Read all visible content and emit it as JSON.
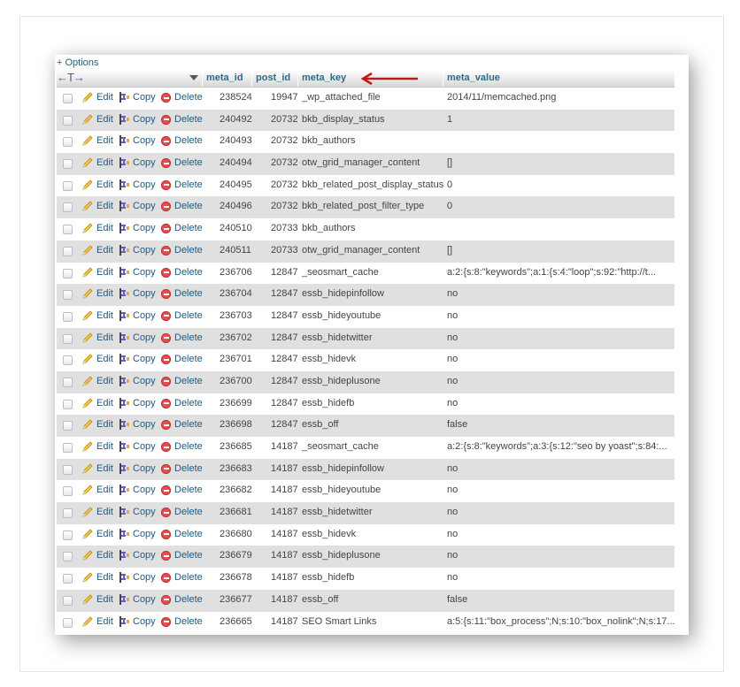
{
  "options_label": "Options",
  "options_prefix": "+",
  "columns": {
    "meta_id": "meta_id",
    "post_id": "post_id",
    "meta_key": "meta_key",
    "meta_value": "meta_value"
  },
  "actions": {
    "edit": "Edit",
    "copy": "Copy",
    "delete": "Delete"
  },
  "colors": {
    "link": "#235a81",
    "header_text": "#2e6a8a",
    "row_alt": "#e0e0e0",
    "annotation_arrow": "#c0191b"
  },
  "rows": [
    {
      "meta_id": "238524",
      "post_id": "19947",
      "meta_key": "_wp_attached_file",
      "meta_value": "2014/11/memcached.png"
    },
    {
      "meta_id": "240492",
      "post_id": "20732",
      "meta_key": "bkb_display_status",
      "meta_value": "1"
    },
    {
      "meta_id": "240493",
      "post_id": "20732",
      "meta_key": "bkb_authors",
      "meta_value": ""
    },
    {
      "meta_id": "240494",
      "post_id": "20732",
      "meta_key": "otw_grid_manager_content",
      "meta_value": "[]"
    },
    {
      "meta_id": "240495",
      "post_id": "20732",
      "meta_key": "bkb_related_post_display_status",
      "meta_value": "0"
    },
    {
      "meta_id": "240496",
      "post_id": "20732",
      "meta_key": "bkb_related_post_filter_type",
      "meta_value": "0"
    },
    {
      "meta_id": "240510",
      "post_id": "20733",
      "meta_key": "bkb_authors",
      "meta_value": ""
    },
    {
      "meta_id": "240511",
      "post_id": "20733",
      "meta_key": "otw_grid_manager_content",
      "meta_value": "[]"
    },
    {
      "meta_id": "236706",
      "post_id": "12847",
      "meta_key": "_seosmart_cache",
      "meta_value": "a:2:{s:8:\"keywords\";a:1:{s:4:\"loop\";s:92:\"http://t..."
    },
    {
      "meta_id": "236704",
      "post_id": "12847",
      "meta_key": "essb_hidepinfollow",
      "meta_value": "no"
    },
    {
      "meta_id": "236703",
      "post_id": "12847",
      "meta_key": "essb_hideyoutube",
      "meta_value": "no"
    },
    {
      "meta_id": "236702",
      "post_id": "12847",
      "meta_key": "essb_hidetwitter",
      "meta_value": "no"
    },
    {
      "meta_id": "236701",
      "post_id": "12847",
      "meta_key": "essb_hidevk",
      "meta_value": "no"
    },
    {
      "meta_id": "236700",
      "post_id": "12847",
      "meta_key": "essb_hideplusone",
      "meta_value": "no"
    },
    {
      "meta_id": "236699",
      "post_id": "12847",
      "meta_key": "essb_hidefb",
      "meta_value": "no"
    },
    {
      "meta_id": "236698",
      "post_id": "12847",
      "meta_key": "essb_off",
      "meta_value": "false"
    },
    {
      "meta_id": "236685",
      "post_id": "14187",
      "meta_key": "_seosmart_cache",
      "meta_value": "a:2:{s:8:\"keywords\";a:3:{s:12:\"seo by yoast\";s:84:..."
    },
    {
      "meta_id": "236683",
      "post_id": "14187",
      "meta_key": "essb_hidepinfollow",
      "meta_value": "no"
    },
    {
      "meta_id": "236682",
      "post_id": "14187",
      "meta_key": "essb_hideyoutube",
      "meta_value": "no"
    },
    {
      "meta_id": "236681",
      "post_id": "14187",
      "meta_key": "essb_hidetwitter",
      "meta_value": "no"
    },
    {
      "meta_id": "236680",
      "post_id": "14187",
      "meta_key": "essb_hidevk",
      "meta_value": "no"
    },
    {
      "meta_id": "236679",
      "post_id": "14187",
      "meta_key": "essb_hideplusone",
      "meta_value": "no"
    },
    {
      "meta_id": "236678",
      "post_id": "14187",
      "meta_key": "essb_hidefb",
      "meta_value": "no"
    },
    {
      "meta_id": "236677",
      "post_id": "14187",
      "meta_key": "essb_off",
      "meta_value": "false"
    },
    {
      "meta_id": "236665",
      "post_id": "14187",
      "meta_key": "SEO Smart Links",
      "meta_value": "a:5:{s:11:\"box_process\";N;s:10:\"box_nolink\";N;s:17..."
    }
  ]
}
